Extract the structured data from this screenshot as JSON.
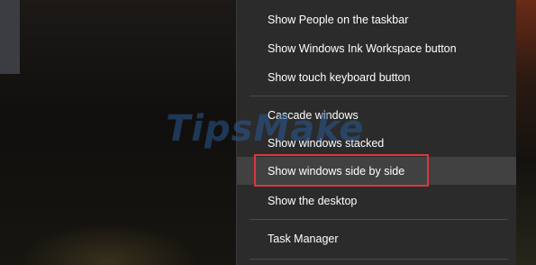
{
  "menu": {
    "items": [
      "Show People on the taskbar",
      "Show Windows Ink Workspace button",
      "Show touch keyboard button",
      "Cascade windows",
      "Show windows stacked",
      "Show windows side by side",
      "Show the desktop",
      "Task Manager"
    ],
    "hovered_item": "Show windows side by side"
  },
  "watermark": {
    "text": "TipsMake"
  },
  "colors": {
    "menu_background": "#2b2b2b",
    "hover_background": "#414141",
    "highlight_border": "#d9383c",
    "text": "#ffffff"
  }
}
